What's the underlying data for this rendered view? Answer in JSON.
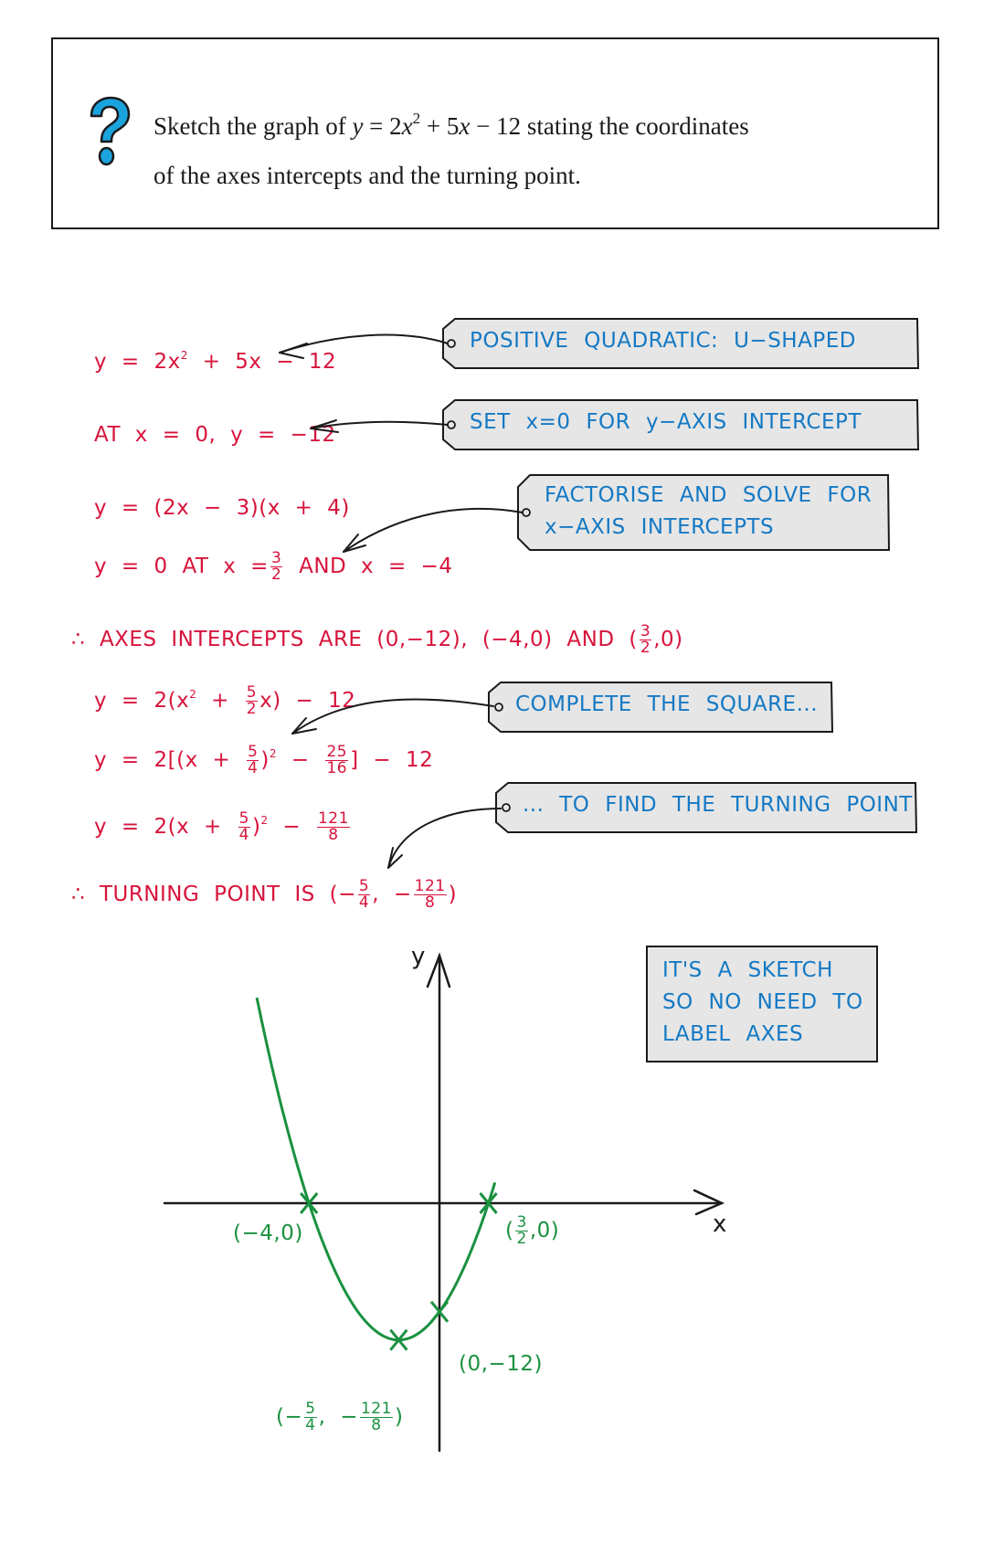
{
  "question": {
    "icon": "question-mark-icon",
    "line1_prefix": "Sketch the graph of ",
    "equation_y": "y",
    "equation_eq": " = 2",
    "equation_x": "x",
    "equation_exp": "2",
    "equation_rest": " + 5",
    "equation_x2": "x",
    "equation_tail": " − 12",
    "line1_suffix": " stating the coordinates",
    "line2": "of the axes intercepts and the turning point."
  },
  "working": {
    "step1": {
      "a": "y = 2x",
      "sup": "2",
      "b": " + 5x − 12"
    },
    "step2": "AT  x = 0,  y = −12",
    "step3": "y = (2x − 3)(x + 4)",
    "step4": {
      "a": "y = 0   AT   x =",
      "num": "3",
      "den": "2",
      "b": "  AND   x = −4"
    },
    "step5": {
      "a": "∴ AXES   INTERCEPTS   ARE   (0,−12),  (−4,0)  AND  (",
      "num": "3",
      "den": "2",
      "b": ",0)"
    },
    "step6": {
      "a": "y = 2(x",
      "sup": "2",
      "b": " + ",
      "num": "5",
      "den": "2",
      "c": "x) − 12"
    },
    "step7": {
      "a": "y = 2[(x + ",
      "num1": "5",
      "den1": "4",
      "b": ")",
      "sup": "2",
      "c": " − ",
      "num2": "25",
      "den2": "16",
      "d": "] − 12"
    },
    "step8": {
      "a": "y = 2(x + ",
      "num1": "5",
      "den1": "4",
      "b": ")",
      "sup": "2",
      "c": " − ",
      "num2": "121",
      "den2": "8"
    },
    "step9": {
      "a": "∴ TURNING   POINT   IS  (−",
      "num1": "5",
      "den1": "4",
      "b": ", −",
      "num2": "121",
      "den2": "8",
      "c": ")"
    }
  },
  "annotations": {
    "positive_quadratic": "POSITIVE  QUADRATIC:  U−SHAPED",
    "set_x0": "SET  x=0  FOR  y−AXIS  INTERCEPT",
    "factorise_line1": "FACTORISE  AND  SOLVE  FOR",
    "factorise_line2": "x−AXIS  INTERCEPTS",
    "complete_square": "COMPLETE  THE  SQUARE...",
    "find_turning": "... TO  FIND  THE  TURNING  POINT",
    "sketch_note": [
      "IT'S  A  SKETCH",
      "SO  NO  NEED  TO",
      "LABEL  AXES"
    ]
  },
  "graph": {
    "x_axis_label": "x",
    "y_axis_label": "y",
    "points": {
      "x_int_left": "(−4,0)",
      "x_int_right": {
        "a": "(",
        "num": "3",
        "den": "2",
        "b": ",0)"
      },
      "y_int": "(0,−12)",
      "turning": {
        "a": "(−",
        "num1": "5",
        "den1": "4",
        "b": ", −",
        "num2": "121",
        "den2": "8",
        "c": ")"
      }
    },
    "colors": {
      "curve": "#1a9140",
      "axes": "#1a1a1a"
    }
  },
  "chart_data": {
    "type": "line",
    "title": "y = 2x² + 5x − 12",
    "xlabel": "x",
    "ylabel": "y",
    "function": "2x^2 + 5x - 12",
    "xlim": [
      -6.4,
      4.4
    ],
    "marked_points": [
      {
        "label": "(-4,0)",
        "x": -4,
        "y": 0
      },
      {
        "label": "(3/2,0)",
        "x": 1.5,
        "y": 0
      },
      {
        "label": "(0,-12)",
        "x": 0,
        "y": -12
      },
      {
        "label": "(-5/4,-121/8)",
        "x": -1.25,
        "y": -15.125
      }
    ],
    "grid": false,
    "axis_ticks": "none"
  },
  "colors": {
    "working": "#d7143c",
    "annotation": "#1479c4",
    "graph": "#1a9140",
    "tag_fill": "#e6e6e6",
    "icon": "#1aa3dd"
  }
}
